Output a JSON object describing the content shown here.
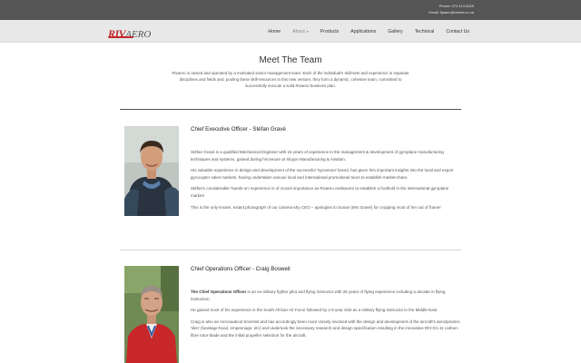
{
  "topbar": {
    "phone": "Phone: 072 413 6425",
    "email": "Email: flyaero@mweb.co.za"
  },
  "logo": {
    "riv": "RIV",
    "aero": "AERO"
  },
  "nav": {
    "home": "Home",
    "about": "About",
    "products": "Products",
    "applications": "Applications",
    "gallery": "Gallery",
    "technical": "Technical",
    "contact": "Contact Us"
  },
  "page": {
    "title": "Meet The Team",
    "intro": "Rivaero is owned and operated by a motivated senior management team. Each of the individual's skill-sets and experience in separate disciplines and fields and, pooling these skill-resources in this new venture, they form a dynamic, cohesive team, committed to successfully execute a solid Rivaero business plan."
  },
  "members": [
    {
      "heading": "Chief Executive Officer - Stéfan Gravé",
      "paragraphs": [
        "Stéfan Gravé is a qualified Mechanical Engineer with 15 years of experience in the management & development of gyroplane manufacturing techniques and systems, gained during his tenure at Skyjon Manufacturing & Aviation.",
        "His valuable experience in design and development of the successful 'Sycamore' brand, has given him important insights into the local and export gyrocopter sales markets, having undertaken various local and international promotional tours to establish market-share.",
        "Stéfan's considerable 'hands-on' experience is of crucial importance as Rivaero endeavors to establish a foothold in the international gyroplane market!",
        "This is the only known, extant photograph of our camera-shy CEO – apologies to Sunan (Mrs Gravé) for cropping most of her out of frame!"
      ]
    },
    {
      "heading": "Chief Operations Officer - Craig Boswell",
      "p1_bold": "The Chief Operations Officer",
      "p1_rest": " is an ex-military fighter pilot and flying instructor with 25 years of flying experience including a decade in flying instruction.",
      "paragraphs": [
        "He gained most of his experience in the South African Air Force followed by a 5-year stint as a military flying instructor in the Middle-East.",
        "Craig is also an Aeronautical Scientist and has accordingly been more closely involved with the design and development of the aircraft's aerodynamic 'skin' (fuselage-hood, empennage, etc) and undertook the necessary research and design specification resulting in the innovative RIV-G1-11 carbon-fibre rotor-blade and the initial propeller selection for the aircraft."
      ]
    }
  ],
  "colors": {
    "topbar": "#555555",
    "navbar": "#e8e8e8",
    "brand_red": "#c0262c"
  }
}
